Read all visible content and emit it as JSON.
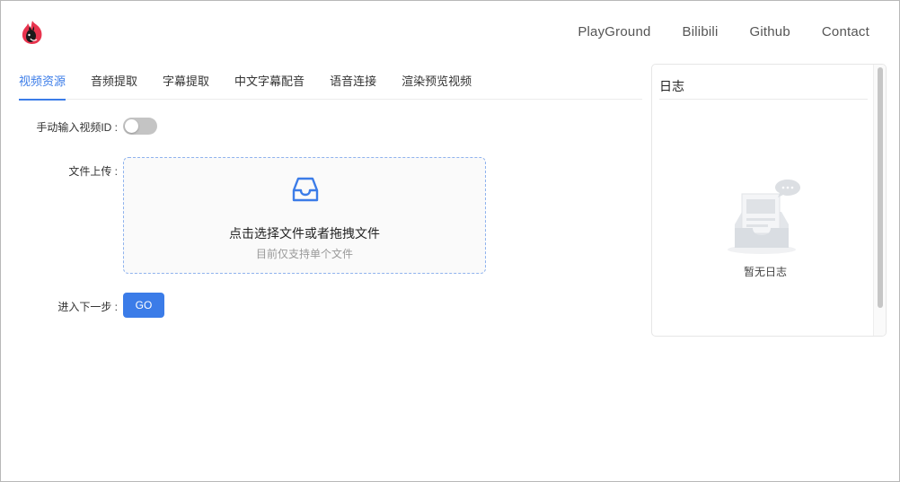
{
  "header": {
    "logo": "flame-cat-logo-icon",
    "nav": [
      "PlayGround",
      "Bilibili",
      "Github",
      "Contact"
    ]
  },
  "tabs": [
    {
      "label": "视频资源",
      "active": true
    },
    {
      "label": "音频提取",
      "active": false
    },
    {
      "label": "字幕提取",
      "active": false
    },
    {
      "label": "中文字幕配音",
      "active": false
    },
    {
      "label": "语音连接",
      "active": false
    },
    {
      "label": "渲染预览视频",
      "active": false
    }
  ],
  "form": {
    "manual_label": "手动输入视频ID :",
    "manual_toggle_on": false,
    "upload_label": "文件上传 :",
    "upload_icon": "inbox-icon",
    "upload_text": "点击选择文件或者拖拽文件",
    "upload_hint": "目前仅支持单个文件",
    "next_label": "进入下一步 :",
    "go_button": "GO"
  },
  "log": {
    "title": "日志",
    "empty_text": "暂无日志"
  },
  "colors": {
    "accent": "#3b7ce8",
    "logo_red": "#e8344e",
    "toggle_off": "#c4c4c4"
  }
}
